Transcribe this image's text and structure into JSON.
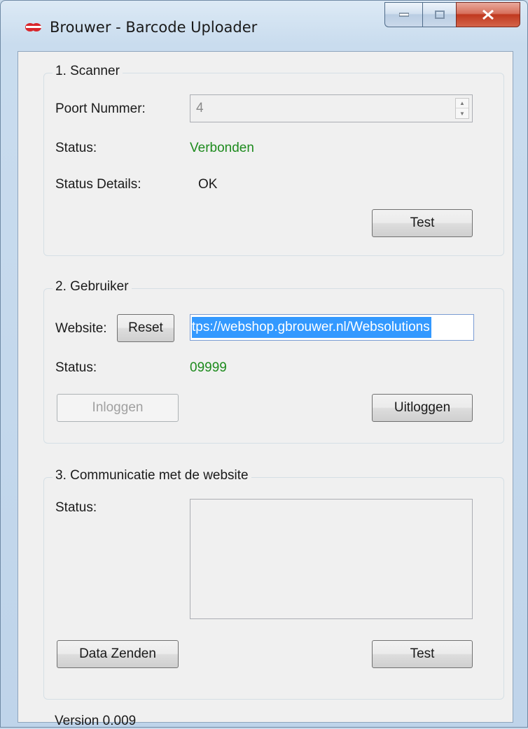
{
  "window": {
    "title": "Brouwer - Barcode Uploader"
  },
  "scanner": {
    "group_title": "1. Scanner",
    "port_label": "Poort Nummer:",
    "port_value": "4",
    "status_label": "Status:",
    "status_value": "Verbonden",
    "details_label": "Status Details:",
    "details_value": "OK",
    "test_button": "Test"
  },
  "user": {
    "group_title": "2. Gebruiker",
    "website_label": "Website:",
    "reset_button": "Reset",
    "website_value": "tps://webshop.gbrouwer.nl/Websolutions",
    "status_label": "Status:",
    "status_value": "09999",
    "login_button": "Inloggen",
    "logout_button": "Uitloggen"
  },
  "communication": {
    "group_title": "3. Communicatie met de website",
    "status_label": "Status:",
    "status_text": "",
    "send_button": "Data Zenden",
    "test_button": "Test"
  },
  "version": "Version 0.009",
  "colors": {
    "status_ok": "#1e8b1e",
    "selection": "#3399ff"
  }
}
